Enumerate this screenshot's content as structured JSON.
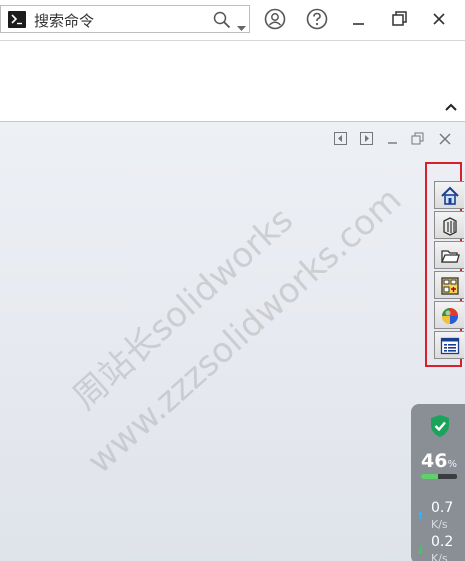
{
  "search": {
    "placeholder": "搜索命令"
  },
  "viewport": {
    "watermark_line1": "周站长solidworks",
    "watermark_line2": "www.zzzsolidworks.com"
  },
  "task_pane": {
    "tabs": [
      {
        "icon": "home-icon"
      },
      {
        "icon": "design-library-icon"
      },
      {
        "icon": "file-explorer-icon"
      },
      {
        "icon": "view-palette-icon"
      },
      {
        "icon": "appearances-icon"
      },
      {
        "icon": "custom-properties-icon"
      }
    ]
  },
  "network_monitor": {
    "memory_percent": "46",
    "memory_unit": "%",
    "memory_fraction": 0.46,
    "upload_value": "0.7",
    "upload_unit": "K/s",
    "download_value": "0.2",
    "download_unit": "K/s",
    "colors": {
      "shield": "#1aa35a",
      "bar": "#5fd06b",
      "up": "#38b6ff",
      "down": "#3ecf59"
    }
  }
}
